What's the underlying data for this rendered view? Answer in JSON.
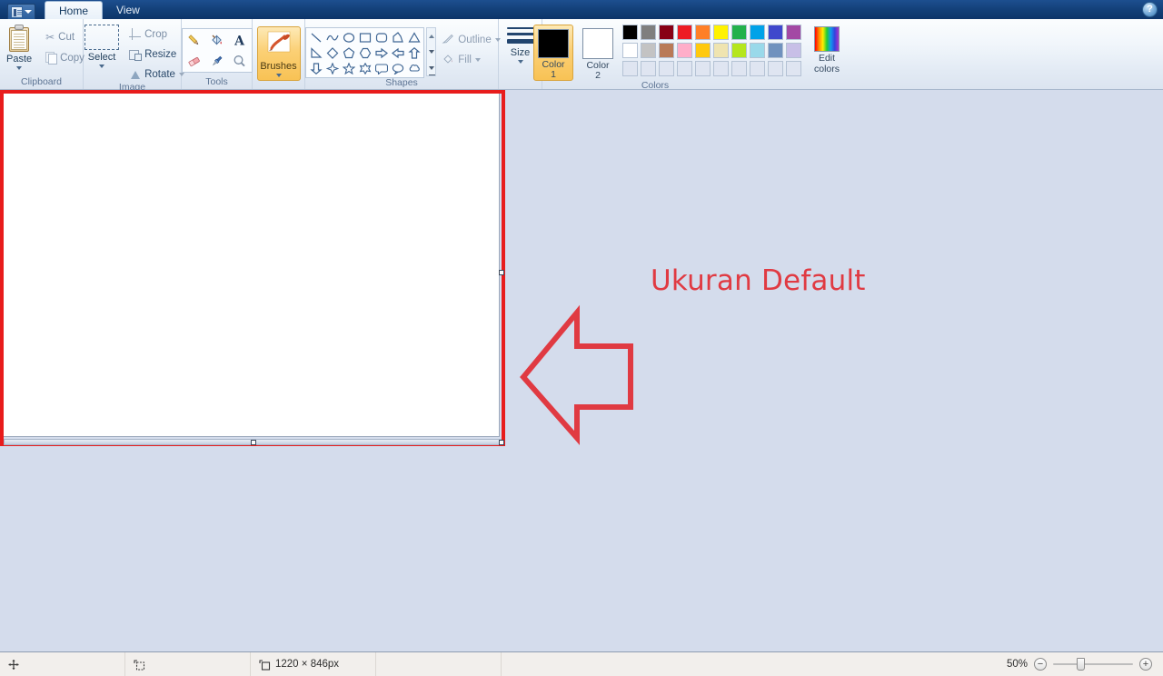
{
  "window": {
    "quick_access": {
      "icon": "paint-menu-icon",
      "caret": "chevron-down-icon"
    },
    "tabs": [
      {
        "label": "Home",
        "active": true
      },
      {
        "label": "View",
        "active": false
      }
    ],
    "help_button": "?"
  },
  "ribbon": {
    "groups": [
      {
        "name": "Clipboard",
        "label": "Clipboard",
        "paste": {
          "label": "Paste",
          "icon": "clipboard-icon"
        },
        "cut": {
          "label": "Cut",
          "icon": "scissors-icon"
        },
        "copy": {
          "label": "Copy",
          "icon": "copy-icon"
        }
      },
      {
        "name": "Image",
        "label": "Image",
        "select": {
          "label": "Select",
          "icon": "selection-rectangle-icon"
        },
        "crop": {
          "label": "Crop",
          "icon": "crop-icon"
        },
        "resize": {
          "label": "Resize",
          "icon": "resize-icon"
        },
        "rotate": {
          "label": "Rotate",
          "icon": "rotate-icon"
        }
      },
      {
        "name": "Tools",
        "label": "Tools",
        "tools": [
          "pencil-icon",
          "fill-with-color-icon",
          "text-icon",
          "eraser-icon",
          "color-picker-icon",
          "magnifier-icon"
        ]
      },
      {
        "name": "Brushes",
        "brushes": {
          "label": "Brushes",
          "icon": "paintbrush-icon"
        }
      },
      {
        "name": "Shapes",
        "label": "Shapes",
        "shapes": [
          "line",
          "curve",
          "oval",
          "rectangle",
          "rounded-rectangle",
          "polygon",
          "triangle",
          "right-triangle",
          "diamond",
          "pentagon",
          "hexagon",
          "right-arrow",
          "left-arrow",
          "up-arrow",
          "down-arrow",
          "four-point-star",
          "five-point-star",
          "six-point-star",
          "rounded-callout",
          "oval-callout",
          "cloud-callout"
        ],
        "outline": {
          "label": "Outline",
          "icon": "outline-pen-icon"
        },
        "fill": {
          "label": "Fill",
          "icon": "fill-bucket-icon"
        }
      },
      {
        "name": "Size",
        "size": {
          "label": "Size",
          "icon": "line-thickness-icon"
        }
      },
      {
        "name": "Colors",
        "label": "Colors",
        "color1": {
          "label_line1": "Color",
          "label_line2": "1",
          "value": "#000000"
        },
        "color2": {
          "label_line1": "Color",
          "label_line2": "2",
          "value": "#ffffff"
        },
        "palette_row1": [
          "#000000",
          "#7f7f7f",
          "#880015",
          "#ed1c24",
          "#ff7f27",
          "#fff200",
          "#22b14c",
          "#00a2e8",
          "#3f48cc",
          "#a349a4"
        ],
        "palette_row2": [
          "#ffffff",
          "#c3c3c3",
          "#b97a57",
          "#ffaec9",
          "#ffc90e",
          "#efe4b0",
          "#b5e61d",
          "#99d9ea",
          "#7092be",
          "#c8bfe7"
        ],
        "palette_row3": [
          "#dfe5f1",
          "#dfe5f1",
          "#dfe5f1",
          "#dfe5f1",
          "#dfe5f1",
          "#dfe5f1",
          "#dfe5f1",
          "#dfe5f1",
          "#dfe5f1",
          "#dfe5f1"
        ],
        "edit_colors": {
          "label_line1": "Edit",
          "label_line2": "colors",
          "icon": "rainbow-palette-icon"
        }
      }
    ]
  },
  "canvas": {
    "highlight_color": "#e81c1c",
    "paper_color": "#ffffff",
    "handles": [
      "right-middle-handle",
      "bottom-middle-handle",
      "bottom-right-corner-handle"
    ]
  },
  "annotation": {
    "text": "Ukuran Default",
    "color": "#e03a42",
    "arrow": "left-arrow-annotation"
  },
  "statusbar": {
    "cursor_icon": "cursor-position-icon",
    "selection_icon": "selection-size-icon",
    "image_size_icon": "image-size-icon",
    "image_size": "1220 × 846px",
    "zoom_label": "50%",
    "zoom_out": "−",
    "zoom_in": "+"
  }
}
